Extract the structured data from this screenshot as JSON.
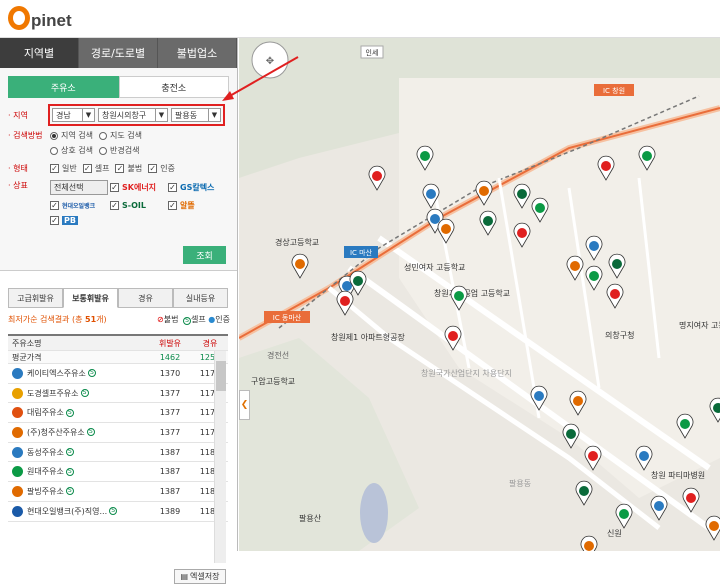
{
  "brand": {
    "logo_text": "pinet"
  },
  "nav": {
    "tabs": [
      "지역별",
      "경로/도로별",
      "불법업소"
    ]
  },
  "station_tabs": [
    "주유소",
    "충전소"
  ],
  "filters": {
    "region_label": "지역",
    "region": {
      "province": "경남",
      "city": "창원시의창구",
      "district": "팔용동"
    },
    "search_label": "검색방법",
    "search_options": [
      "지역 검색",
      "지도 검색",
      "상호 검색",
      "반경검색"
    ],
    "type_label": "형태",
    "type_options": [
      "일반",
      "셀프",
      "불법",
      "인증"
    ],
    "brand_label": "상표",
    "select_all": "전체선택",
    "brands": [
      "SK에너지",
      "GS칼텍스",
      "현대오일뱅크",
      "S-OIL",
      "알뜰",
      "PB"
    ],
    "search_button": "조회"
  },
  "list_tabs": [
    "고급휘발유",
    "보통휘발유",
    "경유",
    "실내등유"
  ],
  "info": {
    "prefix": "최저가순 검색결과 (총 ",
    "count": "51",
    "suffix": "개)",
    "legend": [
      "불법",
      "셀프",
      "인증"
    ]
  },
  "table": {
    "headers": [
      "주유소명",
      "휘발유",
      "경유"
    ],
    "average": {
      "label": "평균가격",
      "gasoline": "1462",
      "diesel": "1256"
    },
    "rows": [
      {
        "name": "케이티엑스주유소",
        "gasoline": "1370",
        "diesel": "1170",
        "color": "#2a7ac0"
      },
      {
        "name": "도경셀프주유소",
        "gasoline": "1377",
        "diesel": "1177",
        "color": "#e8a000"
      },
      {
        "name": "대림주유소",
        "gasoline": "1377",
        "diesel": "1177",
        "color": "#e05010"
      },
      {
        "name": "(주)청주산주유소",
        "gasoline": "1377",
        "diesel": "1177",
        "color": "#e06a00"
      },
      {
        "name": "동성주유소",
        "gasoline": "1387",
        "diesel": "1187",
        "color": "#2a7ac0"
      },
      {
        "name": "원대주유소",
        "gasoline": "1387",
        "diesel": "1187",
        "color": "#0b9a45"
      },
      {
        "name": "팔빙주유소",
        "gasoline": "1387",
        "diesel": "1187",
        "color": "#e06a00"
      },
      {
        "name": "현대오일뱅크(주)직영...",
        "gasoline": "1389",
        "diesel": "1189",
        "color": "#1a5aa8"
      }
    ]
  },
  "excel_button": "엑셀저장",
  "map": {
    "labels": [
      "인세",
      "경상고등학교",
      "성민여자 고등학교",
      "창원제1 아파트형공장",
      "창원국가산업단지 차용단지",
      "구암고등학교",
      "창원기계공업 고등학교",
      "의창구청",
      "명지여자 고등학교",
      "팔용동",
      "창원 파티마병원",
      "팔용산",
      "경전선",
      "신원"
    ],
    "road_signs": [
      "IC 창원",
      "IC 동마산",
      "IC 마산"
    ]
  }
}
